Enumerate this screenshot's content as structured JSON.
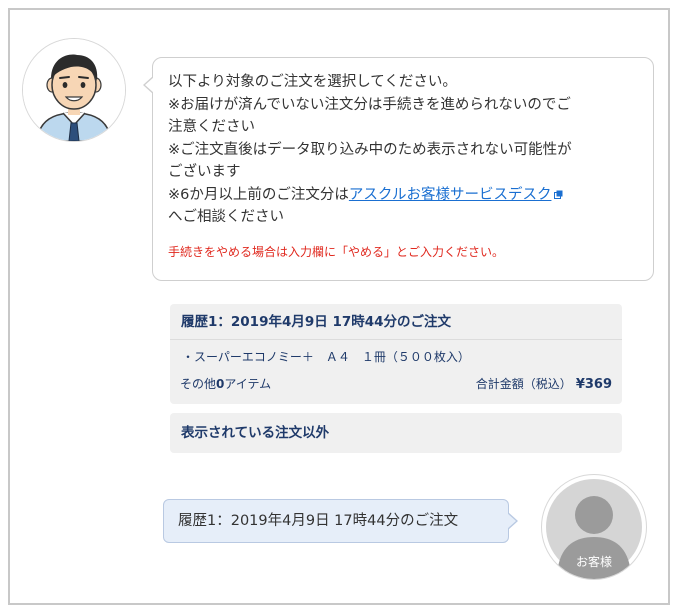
{
  "agent": {
    "message_lines": [
      "以下より対象のご注文を選択してください。",
      "※お届けが済んでいない注文分は手続きを進められないのでご",
      "注意ください",
      "※ご注文直後はデータ取り込み中のため表示されない可能性が",
      "ございます"
    ],
    "six_month_prefix": "※6か月以上前のご注文分は",
    "service_desk_link": "アスクルお客様サービスデスク",
    "six_month_suffix": "へご相談ください",
    "stop_note": "手続きをやめる場合は入力欄に「やめる」とご入力ください。",
    "link_icon": "external-link-icon"
  },
  "order_card": {
    "title": "履歴1：2019年4月9日 17時44分のご注文",
    "item": "・スーパーエコノミー＋　Ａ４　１冊（５００枚入）",
    "other_prefix": "その他",
    "other_count": "0",
    "other_suffix": "アイテム",
    "total_label": "合計金額（税込）",
    "total_amount": "¥369"
  },
  "other_option": "表示されている注文以外",
  "user": {
    "reply": "履歴1：2019年4月9日 17時44分のご注文",
    "avatar_label": "お客様"
  },
  "colors": {
    "accent_text": "#1f3a6a",
    "link": "#1a6fd1",
    "warning": "#e0281e",
    "user_bubble": "#e6eef9"
  }
}
